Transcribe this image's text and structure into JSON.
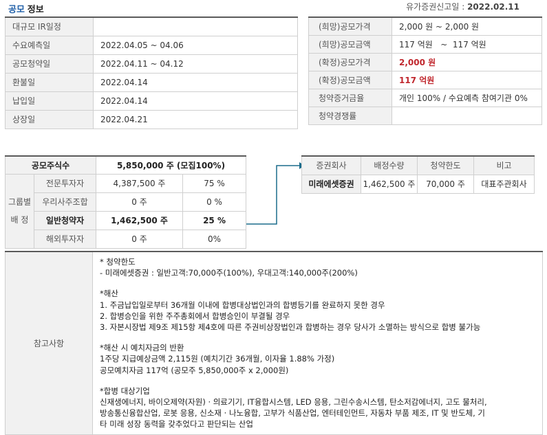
{
  "header": {
    "title_part1": "공모",
    "title_part2": "정보",
    "filing_date_label": "유가증권신고일 :",
    "filing_date_value": "2022.02.11"
  },
  "schedule": [
    {
      "label": "대규모 IR일정",
      "value": ""
    },
    {
      "label": "수요예측일",
      "value": "2022.04.05 ~ 04.06"
    },
    {
      "label": "공모청약일",
      "value": "2022.04.11 ~ 04.12"
    },
    {
      "label": "환불일",
      "value": "2022.04.14"
    },
    {
      "label": "납입일",
      "value": "2022.04.14"
    },
    {
      "label": "상장일",
      "value": "2022.04.21"
    }
  ],
  "pricing": [
    {
      "label": "(희망)공모가격",
      "value": "2,000 원 ~ 2,000 원"
    },
    {
      "label": "(희망)공모금액",
      "value": "117 억원   ~  117 억원"
    },
    {
      "label": "(확정)공모가격",
      "value": "2,000 원"
    },
    {
      "label": "(확정)공모금액",
      "value": "117 억원"
    },
    {
      "label": "청약증거금율",
      "value": "개인 100% / 수요예측 참여기관 0%"
    },
    {
      "label": "청약경쟁률",
      "value": ""
    }
  ],
  "allocation": {
    "total_label": "공모주식수",
    "total_value": "5,850,000  주 (모집100%)",
    "group_label_1": "그룹별",
    "group_label_2": "배 정",
    "rows": [
      {
        "label": "전문투자자",
        "shares": "4,387,500 주",
        "pct": "75 %"
      },
      {
        "label": "우리사주조합",
        "shares": "0 주",
        "pct": "0 %"
      },
      {
        "label": "일반청약자",
        "shares": "1,462,500  주",
        "pct": "25  %"
      },
      {
        "label": "해외투자자",
        "shares": "0 주",
        "pct": "0%"
      }
    ]
  },
  "underwriter": {
    "headers": [
      "증권회사",
      "배정수량",
      "청약한도",
      "비고"
    ],
    "row": {
      "name": "미래에셋증권",
      "qty": "1,462,500 주",
      "limit": "70,000 주",
      "note": "대표주관회사"
    }
  },
  "notes": {
    "label": "참고사항",
    "lines": [
      "* 청약한도",
      "- 미래에셋증권 : 일반고객:70,000주(100%), 우대고객:140,000주(200%)",
      "",
      "*해산",
      "1. 주금납입일로부터 36개월 이내에 합병대상법인과의 합병등기를 완료하지 못한 경우",
      "2. 합병승인을 위한 주주총회에서 합병승인이 부결될 경우",
      "3. 자본시장법 제9조 제15항 제4호에 따른 주권비상장법인과 합병하는 경우 당사가 소멸하는 방식으로 합병 불가능",
      "",
      "*해산 시 예치자금의 반환",
      "1주당 지급예상금액 2,115원 (예치기간 36개월, 이자율 1.88% 가정)",
      "공모예치자금 117억 (공모주 5,850,000주 x 2,000원)",
      "",
      "*합병 대상기업",
      "신재생에너지, 바이오제약(자원) · 의료기기, IT융합시스템, LED 응용, 그린수송시스템, 탄소저감에너지, 고도 물처리,",
      "방송통신융합산업, 로봇 응용, 신소재 · 나노융합, 고부가 식품산업, 엔터테인먼트, 자동차 부품 제조, IT 및 반도체, 기",
      "타 미래 성장 동력을 갖추었다고 판단되는 산업"
    ]
  },
  "colors": {
    "accent_blue": "#1f5fa8",
    "highlight_red": "#c0272d",
    "connector": "#1a6c8c"
  }
}
